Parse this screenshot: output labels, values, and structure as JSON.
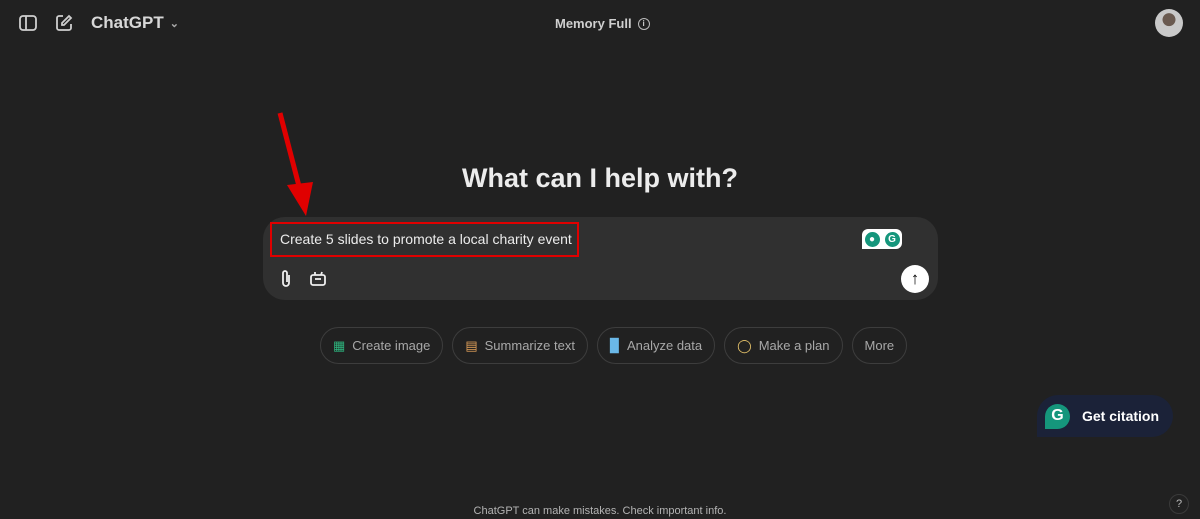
{
  "header": {
    "title": "ChatGPT",
    "memory": "Memory Full"
  },
  "main": {
    "heading": "What can I help with?",
    "prompt": "Create 5 slides to promote a local charity event",
    "chips": [
      {
        "label": "Create image",
        "icon": "image-icon",
        "color": "#2db47d"
      },
      {
        "label": "Summarize text",
        "icon": "document-icon",
        "color": "#e2a15a"
      },
      {
        "label": "Analyze data",
        "icon": "bar-chart-icon",
        "color": "#6ab8e8"
      },
      {
        "label": "Make a plan",
        "icon": "lightbulb-icon",
        "color": "#e6c36a"
      },
      {
        "label": "More"
      }
    ]
  },
  "grammarly": {
    "cite_label": "Get citation",
    "letter": "G"
  },
  "footer": {
    "disclaimer": "ChatGPT can make mistakes. Check important info.",
    "help": "?"
  },
  "annotation": {
    "highlight_color": "#e00000"
  }
}
